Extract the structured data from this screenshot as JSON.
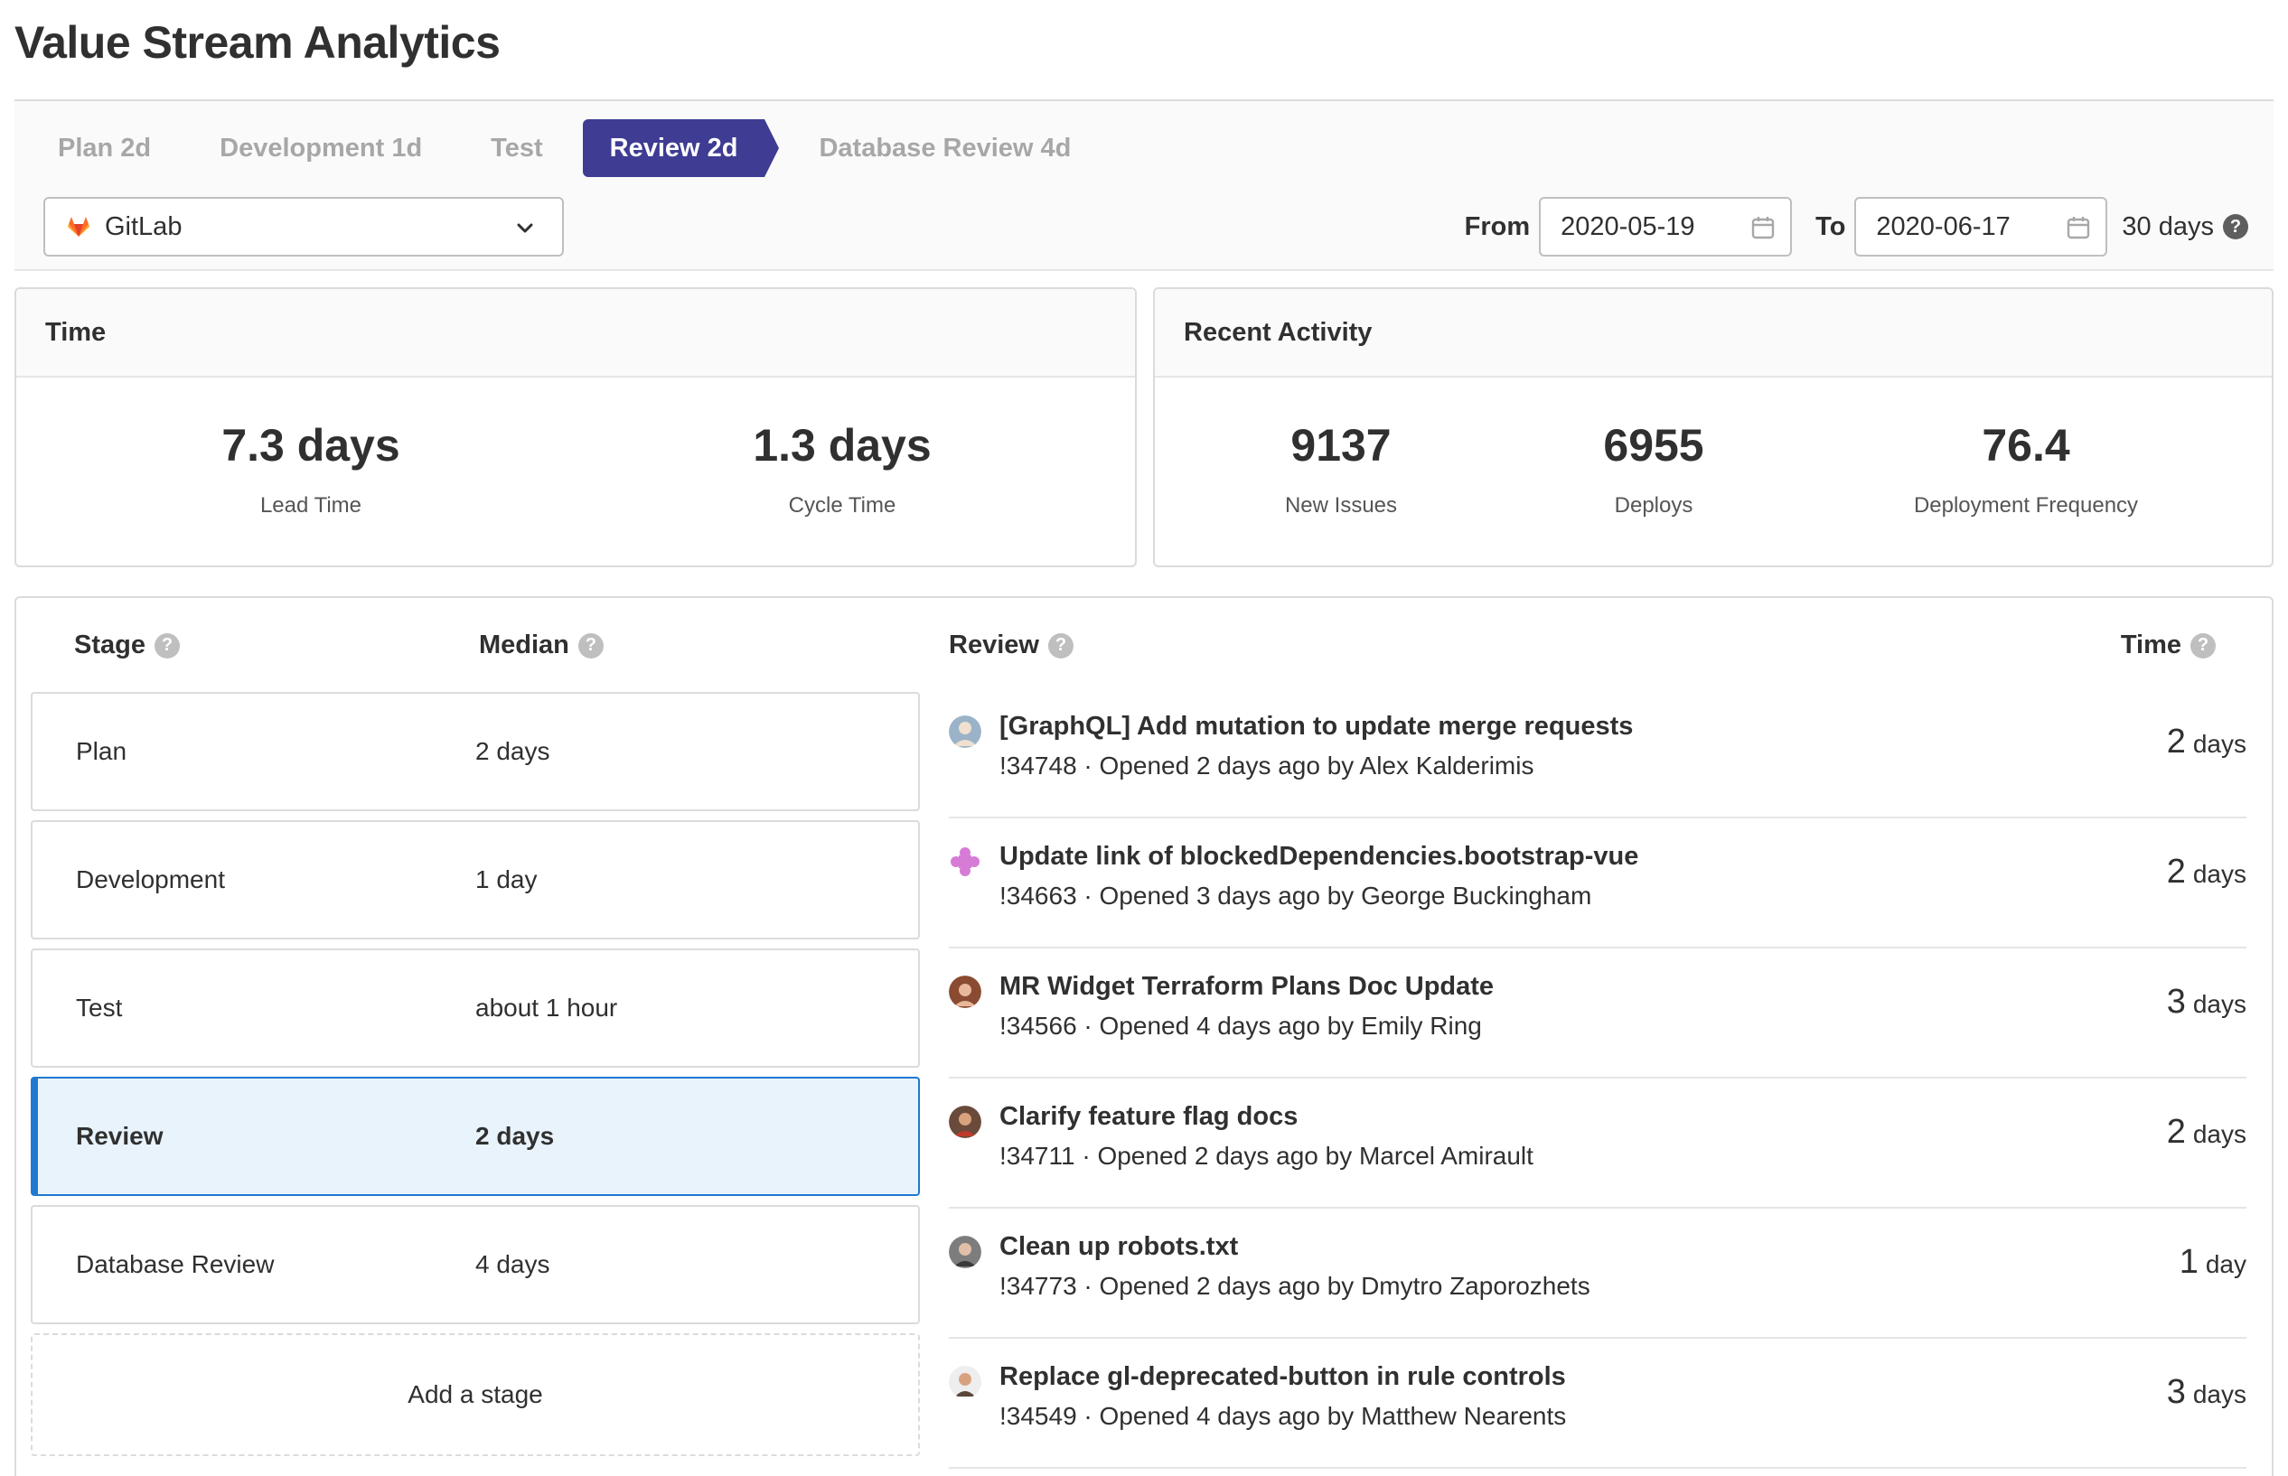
{
  "page": {
    "title": "Value Stream Analytics"
  },
  "path_nav": [
    {
      "label": "Plan 2d",
      "active": false
    },
    {
      "label": "Development 1d",
      "active": false
    },
    {
      "label": "Test",
      "active": false
    },
    {
      "label": "Review 2d",
      "active": true
    },
    {
      "label": "Database Review 4d",
      "active": false
    }
  ],
  "filters": {
    "group": {
      "name": "GitLab",
      "icon": "gitlab-logo-icon"
    },
    "from_label": "From",
    "from_date": "2020-05-19",
    "to_label": "To",
    "to_date": "2020-06-17",
    "days": "30 days",
    "help": "?"
  },
  "time_card": {
    "title": "Time",
    "metrics": [
      {
        "value": "7.3 days",
        "label": "Lead Time"
      },
      {
        "value": "1.3 days",
        "label": "Cycle Time"
      }
    ]
  },
  "activity_card": {
    "title": "Recent Activity",
    "metrics": [
      {
        "value": "9137",
        "label": "New Issues"
      },
      {
        "value": "6955",
        "label": "Deploys"
      },
      {
        "value": "76.4",
        "label": "Deployment Frequency"
      }
    ]
  },
  "stage_table": {
    "headers": {
      "stage": "Stage",
      "median": "Median",
      "events": "Review",
      "time": "Time"
    },
    "stages": [
      {
        "name": "Plan",
        "median": "2 days",
        "active": false
      },
      {
        "name": "Development",
        "median": "1 day",
        "active": false
      },
      {
        "name": "Test",
        "median": "about 1 hour",
        "active": false
      },
      {
        "name": "Review",
        "median": "2 days",
        "active": true
      },
      {
        "name": "Database Review",
        "median": "4 days",
        "active": false
      }
    ],
    "add_stage": "Add a stage",
    "events": [
      {
        "title": "[GraphQL] Add mutation to update merge requests",
        "meta": "!34748 · Opened 2 days ago by Alex Kalderimis",
        "time_num": "2",
        "time_unit": "days",
        "avatar_color": "#9bb3c9"
      },
      {
        "title": "Update link of blockedDependencies.bootstrap-vue",
        "meta": "!34663 · Opened 3 days ago by George Buckingham",
        "time_num": "2",
        "time_unit": "days",
        "avatar_color": "#d67bd6"
      },
      {
        "title": "MR Widget Terraform Plans Doc Update",
        "meta": "!34566 · Opened 4 days ago by Emily Ring",
        "time_num": "3",
        "time_unit": "days",
        "avatar_color": "#8a4b32"
      },
      {
        "title": "Clarify feature flag docs",
        "meta": "!34711 · Opened 2 days ago by Marcel Amirault",
        "time_num": "2",
        "time_unit": "days",
        "avatar_color": "#6a4a3a"
      },
      {
        "title": "Clean up robots.txt",
        "meta": "!34773 · Opened 2 days ago by Dmytro Zaporozhets",
        "time_num": "1",
        "time_unit": "day",
        "avatar_color": "#7d7d7d"
      },
      {
        "title": "Replace gl-deprecated-button in rule controls",
        "meta": "!34549 · Opened 4 days ago by Matthew Nearents",
        "time_num": "3",
        "time_unit": "days",
        "avatar_color": "#5a4638"
      }
    ]
  }
}
